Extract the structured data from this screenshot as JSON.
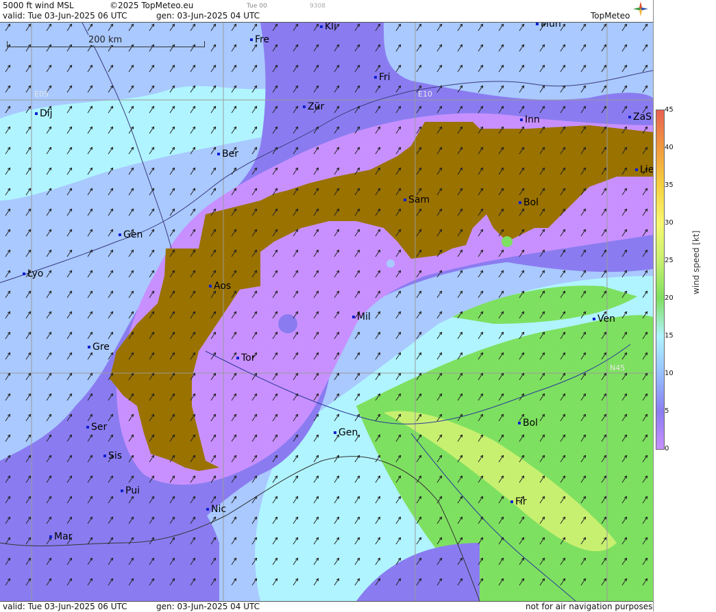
{
  "header": {
    "title": "5000 ft wind MSL",
    "copyright": "©2025 TopMeteo.eu",
    "tab_label": "Tue 00",
    "code": "9308",
    "valid": "valid:  Tue  03-Jun-2025  06 UTC",
    "gen": "gen:  03-Jun-2025  04 UTC",
    "logo": "TopMeteo"
  },
  "footer": {
    "valid": "valid:  Tue  03-Jun-2025  06 UTC",
    "gen": "gen:  03-Jun-2025  04 UTC",
    "disclaimer": "not for air navigation purposes"
  },
  "map": {
    "scale_label": "200 km",
    "grid_labels": [
      "E05",
      "E10",
      "N45"
    ],
    "cities": [
      "Kli",
      "Mun",
      "Fre",
      "Fri",
      "Dij",
      "Zür",
      "Inn",
      "ZaS",
      "Ber",
      "Lie",
      "Sam",
      "Bol",
      "Gen",
      "Lyo",
      "Aos",
      "Mil",
      "Ven",
      "Gre",
      "Tor",
      "Ser",
      "Gen",
      "Bol",
      "Sis",
      "Pui",
      "Fir",
      "Nic",
      "Mar"
    ]
  },
  "legend": {
    "axis_label": "wind speed [kt]",
    "ticks": [
      "45",
      "40",
      "35",
      "30",
      "25",
      "20",
      "15",
      "10",
      "5",
      "0"
    ],
    "colors": [
      "#e86050",
      "#f09a40",
      "#f6d040",
      "#f8f870",
      "#c8f070",
      "#7ee060",
      "#b0f4ff",
      "#96c0ff",
      "#8a7cf0",
      "#c890ff"
    ],
    "terrain_color": "#9a7200"
  }
}
